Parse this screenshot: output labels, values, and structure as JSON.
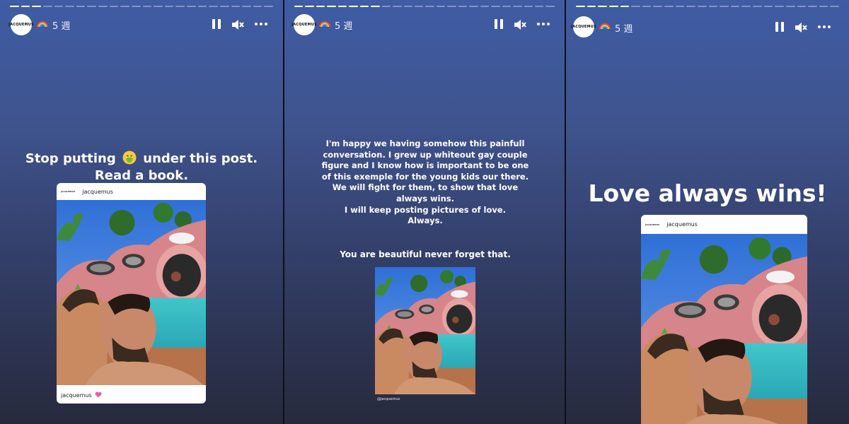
{
  "stories": [
    {
      "avatar_label": "JACQUEMUS",
      "time": "5 週",
      "heading_line1": "Stop putting",
      "heading_line1_end": "under this post.",
      "heading_line2": "Read a book.",
      "card_handle": "jacquemus",
      "card_caption": "jacquemus",
      "progress": {
        "segments": 24,
        "completed": 3
      }
    },
    {
      "avatar_label": "JACQUEMUS",
      "time": "5 週",
      "message_lines": [
        "I'm happy we having somehow this painfull",
        "conversation. I grew up whiteout gay couple",
        "figure and I know how is important to be one",
        "of this exemple for the young kids our there.",
        "We will fight for them, to show that love",
        "always wins.",
        "I will keep posting pictures of love.",
        "Always."
      ],
      "note": "You are beautiful never forget that.",
      "photo_credit": "@jacquemus",
      "progress": {
        "segments": 24,
        "completed": 8
      }
    },
    {
      "avatar_label": "JACQUEMUS",
      "time": "5 週",
      "heading": "Love always wins!",
      "card_handle": "jacquemus",
      "progress": {
        "segments": 24,
        "completed": 5
      }
    }
  ],
  "controls": {
    "pause_icon": "pause-icon",
    "mute_icon": "speaker-muted-icon",
    "more_icon": "more-horizontal-icon",
    "rainbow_emoji": "rainbow-emoji",
    "nauseated_emoji": "nauseated-face-emoji",
    "heart_emoji": "growing-heart-emoji"
  },
  "colors": {
    "gradient_top": "#3f5ca4",
    "gradient_bottom": "#272a3d",
    "text": "#ffffff"
  }
}
